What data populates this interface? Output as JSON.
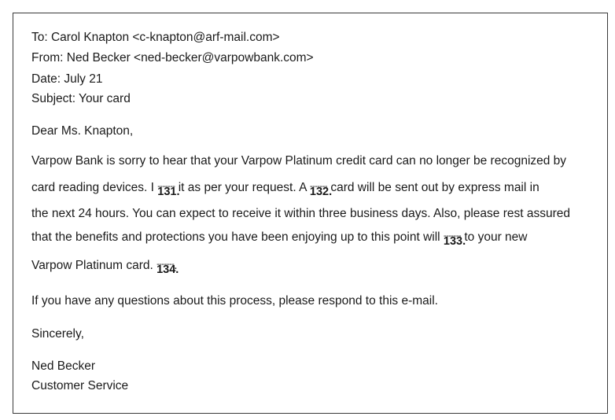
{
  "header": {
    "to": "To: Carol Knapton <c-knapton@arf-mail.com>",
    "from": "From: Ned Becker <ned-becker@varpowbank.com>",
    "date": "Date: July 21",
    "subject": "Subject: Your card"
  },
  "salutation": "Dear Ms. Knapton,",
  "body": {
    "line1": "Varpow Bank is sorry to hear that your Varpow Platinum credit card can no longer be recognized by",
    "line2_a": "card reading devices. I ",
    "blank_131_dashes": "-------",
    "blank_131_num": "131.",
    "line2_b": " it as per your request. A ",
    "blank_132_dashes": "-------",
    "blank_132_num": "132.",
    "line2_c": " card will be sent out by express mail in",
    "line3": "the next 24 hours. You can expect to receive it within three business days. Also, please rest assured",
    "line4_a": "that the benefits and protections you have been enjoying up to this point will ",
    "blank_133_dashes": "-------",
    "blank_133_num": "133.",
    "line4_b": " to your new",
    "line5_a": "Varpow Platinum card. ",
    "blank_134_dashes": "-------",
    "blank_134_num": "134.",
    "line5_b": "."
  },
  "closing_paragraph": "If you have any questions about this process, please respond to this e-mail.",
  "signoff": "Sincerely,",
  "signature": {
    "name": "Ned Becker",
    "department": "Customer Service"
  }
}
